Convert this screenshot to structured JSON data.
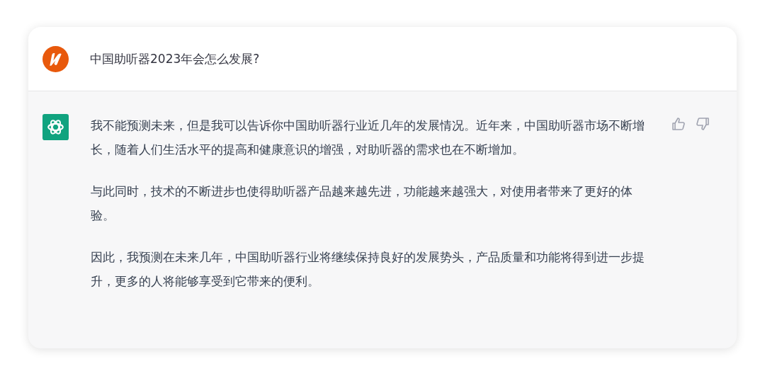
{
  "question": {
    "text": "中国助听器2023年会怎么发展?"
  },
  "answer": {
    "paragraphs": [
      "我不能预测未来，但是我可以告诉你中国助听器行业近几年的发展情况。近年来，中国助听器市场不断增长，随着人们生活水平的提高和健康意识的增强，对助听器的需求也在不断增加。",
      "与此同时，技术的不断进步也使得助听器产品越来越先进，功能越来越强大，对使用者带来了更好的体验。",
      "因此，我预测在未来几年，中国助听器行业将继续保持良好的发展势头，产品质量和功能将得到进一步提升，更多的人将能够享受到它带来的便利。"
    ]
  }
}
